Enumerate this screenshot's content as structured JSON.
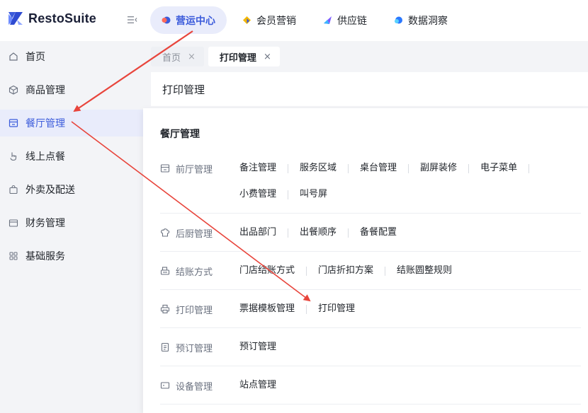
{
  "app": {
    "name": "RestoSuite"
  },
  "top_tabs": [
    {
      "label": "营运中心",
      "active": true,
      "icon": "operations-icon",
      "color": "#3b5bdb"
    },
    {
      "label": "会员营销",
      "active": false,
      "icon": "member-icon",
      "color": "#f5b800"
    },
    {
      "label": "供应链",
      "active": false,
      "icon": "supply-icon",
      "color": "#7c5cff"
    },
    {
      "label": "数据洞察",
      "active": false,
      "icon": "data-icon",
      "color": "#2b78ff"
    }
  ],
  "sidebar": {
    "items": [
      {
        "label": "首页",
        "icon": "home-icon"
      },
      {
        "label": "商品管理",
        "icon": "box-icon"
      },
      {
        "label": "餐厅管理",
        "icon": "store-icon",
        "active": true
      },
      {
        "label": "线上点餐",
        "icon": "pointer-icon"
      },
      {
        "label": "外卖及配送",
        "icon": "bag-icon"
      },
      {
        "label": "财务管理",
        "icon": "folder-icon"
      },
      {
        "label": "基础服务",
        "icon": "grid-icon"
      }
    ]
  },
  "page_tabs": [
    {
      "label": "首页",
      "close": "×",
      "active": false
    },
    {
      "label": "打印管理",
      "close": "×",
      "active": true
    }
  ],
  "page_title": "打印管理",
  "panel": {
    "title": "餐厅管理",
    "groups": [
      {
        "label": "前厅管理",
        "icon": "storefront-icon",
        "items": [
          "备注管理",
          "服务区域",
          "桌台管理",
          "副屏装修",
          "电子菜单",
          "小费管理",
          "叫号屏"
        ]
      },
      {
        "label": "后厨管理",
        "icon": "chef-hat-icon",
        "items": [
          "出品部门",
          "出餐顺序",
          "备餐配置"
        ]
      },
      {
        "label": "结账方式",
        "icon": "cashier-icon",
        "items": [
          "门店结账方式",
          "门店折扣方案",
          "结账圆整规则"
        ]
      },
      {
        "label": "打印管理",
        "icon": "printer-icon",
        "items": [
          "票据模板管理",
          "打印管理"
        ]
      },
      {
        "label": "预订管理",
        "icon": "reservation-icon",
        "items": [
          "预订管理"
        ]
      },
      {
        "label": "设备管理",
        "icon": "device-icon",
        "items": [
          "站点管理"
        ]
      }
    ]
  },
  "annotation_color": "#e8453c"
}
